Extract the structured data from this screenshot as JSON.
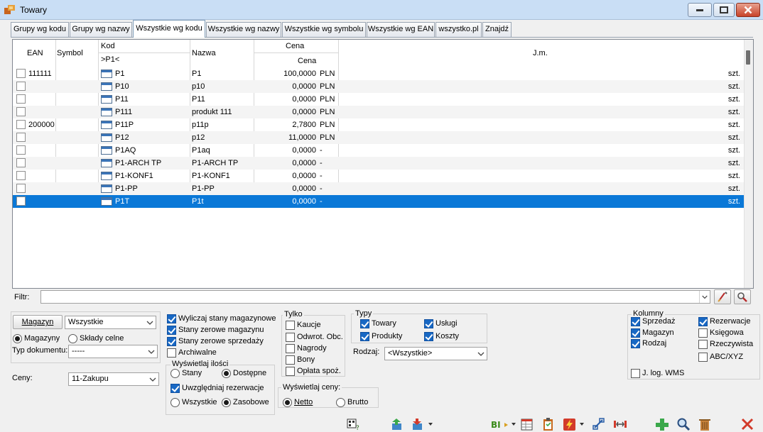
{
  "window": {
    "title": "Towary"
  },
  "tabs": [
    {
      "label": "Grupy wg kodu"
    },
    {
      "label": "Grupy wg nazwy"
    },
    {
      "label": "Wszystkie wg kodu"
    },
    {
      "label": "Wszystkie wg nazwy"
    },
    {
      "label": "Wszystkie wg symbolu"
    },
    {
      "label": "Wszystkie wg EAN"
    },
    {
      "label": "wszystko.pl"
    },
    {
      "label": "Znajdź"
    }
  ],
  "grid": {
    "headers": {
      "ean": "EAN",
      "symbol": "Symbol",
      "kod": "Kod",
      "kod_filter": ">P1<",
      "nazwa": "Nazwa",
      "cena_group": "Cena",
      "cena": "Cena",
      "jm": "J.m."
    },
    "rows": [
      {
        "ean": "111111",
        "kod": "P1",
        "nazwa": "P1",
        "cena": "100,0000",
        "waluta": "PLN",
        "jm": "szt."
      },
      {
        "ean": "",
        "kod": "P10",
        "nazwa": "p10",
        "cena": "0,0000",
        "waluta": "PLN",
        "jm": "szt."
      },
      {
        "ean": "",
        "kod": "P11",
        "nazwa": "P11",
        "cena": "0,0000",
        "waluta": "PLN",
        "jm": "szt."
      },
      {
        "ean": "",
        "kod": "P111",
        "nazwa": "produkt 111",
        "cena": "0,0000",
        "waluta": "PLN",
        "jm": "szt."
      },
      {
        "ean": "200000",
        "kod": "P11P",
        "nazwa": "p11p",
        "cena": "2,7800",
        "waluta": "PLN",
        "jm": "szt."
      },
      {
        "ean": "",
        "kod": "P12",
        "nazwa": "p12",
        "cena": "11,0000",
        "waluta": "PLN",
        "jm": "szt."
      },
      {
        "ean": "",
        "kod": "P1AQ",
        "nazwa": "P1aq",
        "cena": "0,0000",
        "waluta": "-",
        "jm": "szt."
      },
      {
        "ean": "",
        "kod": "P1-ARCH TP",
        "nazwa": "P1-ARCH TP",
        "cena": "0,0000",
        "waluta": "-",
        "jm": "szt."
      },
      {
        "ean": "",
        "kod": "P1-KONF1",
        "nazwa": "P1-KONF1",
        "cena": "0,0000",
        "waluta": "-",
        "jm": "szt."
      },
      {
        "ean": "",
        "kod": "P1-PP",
        "nazwa": "P1-PP",
        "cena": "0,0000",
        "waluta": "-",
        "jm": "szt."
      },
      {
        "ean": "",
        "kod": "P1T",
        "nazwa": "P1t",
        "cena": "0,0000",
        "waluta": "-",
        "jm": "szt.",
        "selected": true
      }
    ]
  },
  "filter": {
    "label": "Filtr:",
    "value": ""
  },
  "magazyn": {
    "button": "Magazyn",
    "select_value": "Wszystkie",
    "radio_magazyny": "Magazyny",
    "radio_sklady": "Składy celne",
    "typ_label": "Typ dokumentu:",
    "typ_value": "-----"
  },
  "ceny": {
    "label": "Ceny:",
    "value": "11-Zakupu"
  },
  "options": {
    "wyliczaj": "Wyliczaj stany magazynowe",
    "zerowe_mag": "Stany zerowe magazynu",
    "zerowe_sprz": "Stany zerowe sprzedaży",
    "archiwalne": "Archiwalne"
  },
  "wyswietlaj_ilosci": {
    "title": "Wyświetlaj ilości",
    "stany": "Stany",
    "dostepne": "Dostępne",
    "uwzgledniaj": "Uwzględniaj rezerwacje",
    "wszystkie": "Wszystkie",
    "zasobowe": "Zasobowe"
  },
  "tylko": {
    "title": "Tylko",
    "kaucje": "Kaucje",
    "odwrot": "Odwrot. Obc.",
    "nagrody": "Nagrody",
    "bony": "Bony",
    "oplata": "Opłata spoż."
  },
  "typy": {
    "title": "Typy",
    "towary": "Towary",
    "uslugi": "Usługi",
    "produkty": "Produkty",
    "koszty": "Koszty"
  },
  "rodzaj": {
    "label": "Rodzaj:",
    "value": "<Wszystkie>"
  },
  "ceny_display": {
    "title": "Wyświetlaj ceny:",
    "netto": "Netto",
    "brutto": "Brutto"
  },
  "kolumny": {
    "title": "Kolumny",
    "sprzedaz": "Sprzedaż",
    "magazyn": "Magazyn",
    "rodzaj": "Rodzaj",
    "rezerwacje": "Rezerwacje",
    "ksiegowa": "Księgowa",
    "rzeczywista": "Rzeczywista",
    "abc": "ABC/XYZ",
    "jlog": "J. log. WMS"
  }
}
